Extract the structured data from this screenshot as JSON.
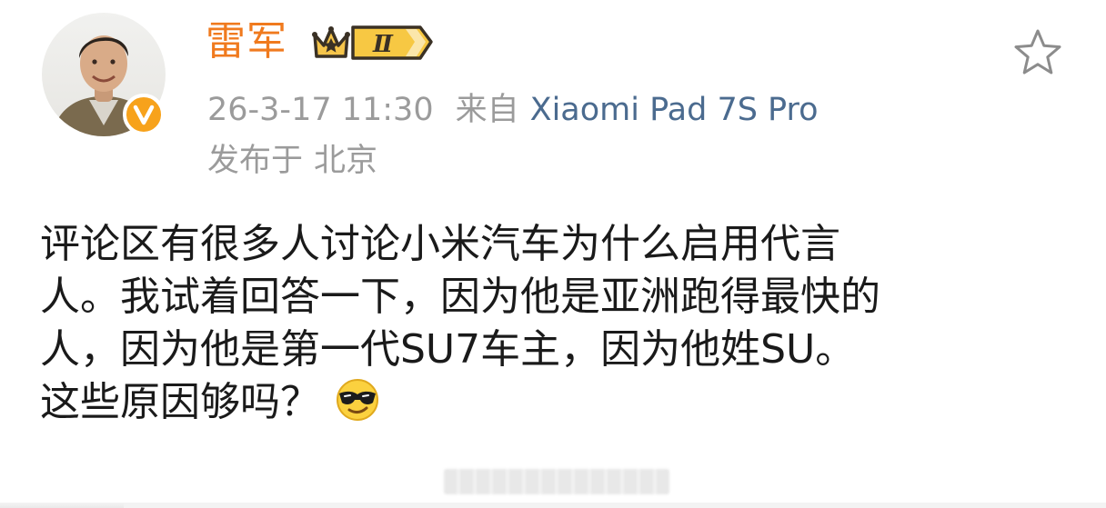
{
  "user": {
    "name": "雷军",
    "level_badge": "Ⅱ",
    "verified_mark": "V"
  },
  "post_meta": {
    "time": "26-3-17 11:30",
    "from_label": "来自",
    "device": "Xiaomi Pad 7S Pro",
    "location_label": "发布于",
    "location": "北京"
  },
  "post": {
    "lines": [
      "评论区有很多人讨论小米汽车为什么启用代言",
      "人。我试着回答一下，因为他是亚洲跑得最快的",
      "人，因为他是第一代SU7车主，因为他姓SU。",
      "这些原因够吗？"
    ]
  },
  "icons": {
    "favorite": "star-outline-icon",
    "verified": "verified-v-icon",
    "crown": "crown-level-icon",
    "emoji": "cool-sunglasses-emoji"
  },
  "colors": {
    "username": "#f07a1e",
    "device_link": "#4b6b8f",
    "meta_gray": "#9b9b9b",
    "badge_orange": "#f7a21b"
  }
}
